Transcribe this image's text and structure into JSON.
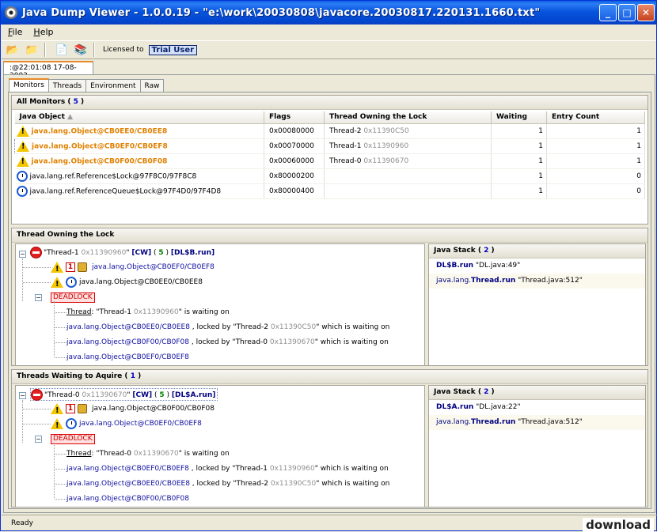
{
  "window": {
    "title": "Java Dump Viewer - 1.0.0.19 - \"e:\\work\\20030808\\javacore.20030817.220131.1660.txt\""
  },
  "menu": {
    "file_hotkey": "F",
    "file_rest": "ile",
    "help_hotkey": "H",
    "help_rest": "elp"
  },
  "toolbar": {
    "licensed_label": "Licensed to",
    "license_value": "Trial User"
  },
  "dump_tab": {
    "label": ":@22:01:08 17-08-2003"
  },
  "tabs": [
    "Monitors",
    "Threads",
    "Environment",
    "Raw"
  ],
  "monitors": {
    "title": "All Monitors",
    "count": "5",
    "columns": [
      "Java Object",
      "Flags",
      "Thread Owning the Lock",
      "Waiting",
      "Entry Count"
    ],
    "rows": [
      {
        "object": "java.lang.Object@CB0EE0/CB0EE8",
        "flags": "0x00080000",
        "thread": "Thread-2",
        "addr": "0x11390C50",
        "waiting": "1",
        "entry": "1",
        "icon": "warning-icon"
      },
      {
        "object": "java.lang.Object@CB0EF0/CB0EF8",
        "flags": "0x00070000",
        "thread": "Thread-1",
        "addr": "0x11390960",
        "waiting": "1",
        "entry": "1",
        "icon": "warning-icon"
      },
      {
        "object": "java.lang.Object@CB0F00/CB0F08",
        "flags": "0x00060000",
        "thread": "Thread-0",
        "addr": "0x11390670",
        "waiting": "1",
        "entry": "1",
        "icon": "warning-icon"
      },
      {
        "object": "java.lang.ref.Reference$Lock@97F8C0/97F8C8",
        "flags": "0x80000200",
        "thread": "",
        "addr": "",
        "waiting": "1",
        "entry": "0",
        "icon": "clock-icon"
      },
      {
        "object": "java.lang.ref.ReferenceQueue$Lock@97F4D0/97F4D8",
        "flags": "0x80000400",
        "thread": "",
        "addr": "",
        "waiting": "1",
        "entry": "0",
        "icon": "clock-icon"
      }
    ]
  },
  "owning": {
    "title": "Thread Owning the Lock",
    "root": {
      "name": "\"Thread-1",
      "addr": "0x11390960",
      "q": "\"",
      "cw": "[CW]",
      "prio": "5",
      "loc": "[DL$B.run]"
    },
    "obj1": "java.lang.Object@CB0EF0/CB0EF8",
    "obj2": "java.lang.Object@CB0EE0/CB0EE8",
    "deadlock": "DEADLOCK",
    "waitline": {
      "label": "Thread",
      "name": ": \"Thread-1",
      "addr": "0x11390960",
      "rest": "\" is waiting on"
    },
    "chain": [
      {
        "obj": "java.lang.Object@CB0EE0/CB0EE8",
        "mid": " , locked by \"Thread-2",
        "addr": "0x11390C50",
        "end": "\" which is waiting on"
      },
      {
        "obj": "java.lang.Object@CB0F00/CB0F08",
        "mid": " , locked by \"Thread-0",
        "addr": "0x11390670",
        "end": "\" which is waiting on"
      }
    ],
    "last": "java.lang.Object@CB0EF0/CB0EF8",
    "stack_title": "Java Stack",
    "stack_count": "2",
    "stack": [
      {
        "cls": "DL$B.",
        "m": "run",
        "src": " \"DL.java:49\""
      },
      {
        "cls": "java.lang.",
        "m": "Thread.run",
        "src": " \"Thread.java:512\""
      }
    ]
  },
  "waiting": {
    "title": "Threads Waiting to Aquire",
    "count": "1",
    "root": {
      "name": "\"Thread-0",
      "addr": "0x11390670",
      "q": "\"",
      "cw": "[CW]",
      "prio": "5",
      "loc": "[DL$A.run]"
    },
    "obj1": "java.lang.Object@CB0F00/CB0F08",
    "obj2": "java.lang.Object@CB0EF0/CB0EF8",
    "deadlock": "DEADLOCK",
    "waitline": {
      "label": "Thread",
      "name": ": \"Thread-0",
      "addr": "0x11390670",
      "rest": "\" is waiting on"
    },
    "chain": [
      {
        "obj": "java.lang.Object@CB0EF0/CB0EF8",
        "mid": " , locked by \"Thread-1",
        "addr": "0x11390960",
        "end": "\" which is waiting on"
      },
      {
        "obj": "java.lang.Object@CB0EE0/CB0EE8",
        "mid": " , locked by \"Thread-2",
        "addr": "0x11390C50",
        "end": "\" which is waiting on"
      }
    ],
    "last": "java.lang.Object@CB0F00/CB0F08",
    "stack_title": "Java Stack",
    "stack_count": "2",
    "stack": [
      {
        "cls": "DL$A.",
        "m": "run",
        "src": " \"DL.java:22\""
      },
      {
        "cls": "java.lang.",
        "m": "Thread.run",
        "src": " \"Thread.java:512\""
      }
    ]
  },
  "status": {
    "text": "Ready"
  },
  "watermark": {
    "text": "download"
  }
}
